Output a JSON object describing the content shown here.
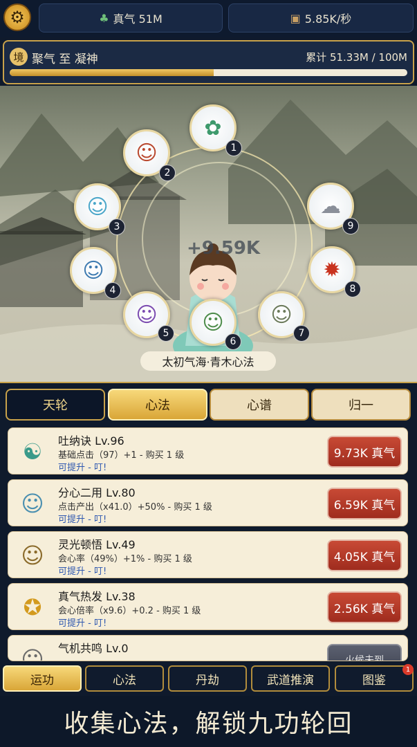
{
  "header": {
    "settings_icon": "gear-icon",
    "qi_label": "真气 51M",
    "qi_icon": "green-beast-icon",
    "rate_label": "5.85K/秒",
    "rate_icon": "chest-icon"
  },
  "realm": {
    "badge": "境",
    "title": "聚气 至 凝神",
    "total": "累计 51.33M / 100M",
    "progress": 0.5133
  },
  "scene": {
    "float_value": "+9.59K",
    "skill_label": "太初气海·青木心法",
    "nodes": [
      {
        "num": "1",
        "icon": "jade-beast-icon"
      },
      {
        "num": "2",
        "icon": "cultivator-red-icon"
      },
      {
        "num": "3",
        "icon": "cultivator-aura-icon"
      },
      {
        "num": "4",
        "icon": "cultivator-blue-icon"
      },
      {
        "num": "5",
        "icon": "cultivator-purple-icon"
      },
      {
        "num": "6",
        "icon": "cultivator-green-icon"
      },
      {
        "num": "7",
        "icon": "elder-icon"
      },
      {
        "num": "8",
        "icon": "flame-warrior-icon"
      },
      {
        "num": "9",
        "icon": "storm-cloud-icon"
      }
    ]
  },
  "tabs": [
    "天轮",
    "心法",
    "心谱",
    "归一"
  ],
  "skills": [
    {
      "name": "吐纳诀  Lv.96",
      "desc": "基础点击（97）+1 - 购买 1 级",
      "hint": "可提升 - 叮!",
      "price": "9.73K 真气",
      "icon": "meditation-icon"
    },
    {
      "name": "分心二用  Lv.80",
      "desc": "点击产出（x41.0）+50% - 购买 1 级",
      "hint": "可提升 - 叮!",
      "price": "6.59K 真气",
      "icon": "twins-icon"
    },
    {
      "name": "灵光顿悟  Lv.49",
      "desc": "会心率（49%）+1% - 购买 1 级",
      "hint": "可提升 - 叮!",
      "price": "4.05K 真气",
      "icon": "sage-icon"
    },
    {
      "name": "真气热发  Lv.38",
      "desc": "会心倍率（x9.6）+0.2 - 购买 1 级",
      "hint": "可提升 - 叮!",
      "price": "2.56K 真气",
      "icon": "golden-badge-icon"
    },
    {
      "name": "气机共鸣  Lv.0",
      "desc": "",
      "hint": "",
      "price": "火候未到",
      "icon": "resonance-icon"
    }
  ],
  "nav": [
    "运功",
    "心法",
    "丹劫",
    "武道推演",
    "图鉴"
  ],
  "nav_badge": "1",
  "banner": "收集心法，解锁九功轮回"
}
